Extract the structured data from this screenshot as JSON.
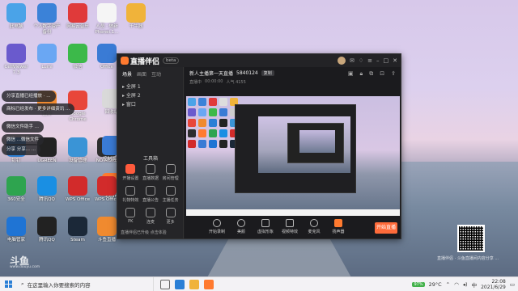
{
  "desktop": {
    "icons": [
      {
        "label": "此电脑",
        "color": "#4aa3e8"
      },
      {
        "label": "个人数字资产备份",
        "color": "#3b82d8"
      },
      {
        "label": "网易云音乐",
        "color": "#e03a3a"
      },
      {
        "label": "人员 · 做新 Phonei.1...",
        "color": "#f5f5f5"
      },
      {
        "label": "千牛器",
        "color": "#f0b33a"
      },
      {
        "label": "CellViewer 7.3",
        "color": "#6a5acd"
      },
      {
        "label": "Lumi",
        "color": "#6aa7f3"
      },
      {
        "label": "微信",
        "color": "#3cb94a"
      },
      {
        "label": "Office",
        "color": "#3a7bd5"
      },
      {
        "label": "回收站",
        "color": "#d9d9d9"
      },
      {
        "label": "Google Chrome",
        "color": "#e8463a"
      },
      {
        "label": "图标",
        "color": "#f08a2f"
      },
      {
        "label": "钉钉",
        "color": "#2a7fd6"
      },
      {
        "label": "UGREEN",
        "color": "#222"
      },
      {
        "label": "设备管理",
        "color": "#3a94d6"
      },
      {
        "label": "NO MORE",
        "color": "#2d2d2d"
      },
      {
        "label": "Steam",
        "color": "#ff7a2f"
      },
      {
        "label": "360安全",
        "color": "#2ea44f"
      },
      {
        "label": "腾讯QQ",
        "color": "#1a8fe3"
      },
      {
        "label": "WPS Office",
        "color": "#d22b2b"
      },
      {
        "label": "WPS Office",
        "color": "#d22b2b"
      },
      {
        "label": "控制面板",
        "color": "#3a7bd5"
      },
      {
        "label": "电脑管家",
        "color": "#1f74d4"
      },
      {
        "label": "腾讯QQ",
        "color": "#222"
      },
      {
        "label": "Steam",
        "color": "#1b2838"
      },
      {
        "label": "斗鱼直播",
        "color": "#f08a2f"
      }
    ],
    "notifications": [
      "分享直播已经播放 · ...",
      "商标已经发布 · 更多详细资讯 ...",
      "微信文件助手 ...",
      "微信 ...微信文件",
      "分享 分享... ..."
    ],
    "logo_text": "斗鱼",
    "logo_sub": "www.douyu.com",
    "watermark": "直播伴侣 · 斗鱼直播间内容分享 ..."
  },
  "app": {
    "brand": "直播伴侣",
    "version": "beta",
    "sidebar": {
      "tabs": [
        "场景",
        "画面",
        "互动"
      ],
      "scenes": [
        "全屏 1",
        "全屏 2",
        "窗口"
      ],
      "tools_title": "工具箱",
      "tools": [
        "开播设置",
        "直播数据",
        "房间管理",
        "礼物特效",
        "直播公告",
        "主播任务",
        "PK",
        "连麦",
        "更多"
      ],
      "footer": "直播伴侣已升级 点击体验"
    },
    "stream": {
      "title": "新人主播第一天直播",
      "id": "5840124",
      "tag": "复制",
      "sub": [
        "直播中",
        "00:00:00",
        "人气 4155"
      ]
    },
    "controls": [
      "开始录制",
      "美颜",
      "虚拟形象",
      "视频特效",
      "麦克风",
      "扬声器"
    ],
    "go_live": "开始直播"
  },
  "taskbar": {
    "search_placeholder": "在这里输入你要搜索的内容",
    "temp": "29°C",
    "battery_badge": "97%",
    "ime": "中",
    "time": "22:08",
    "date": "2021/6/29"
  }
}
